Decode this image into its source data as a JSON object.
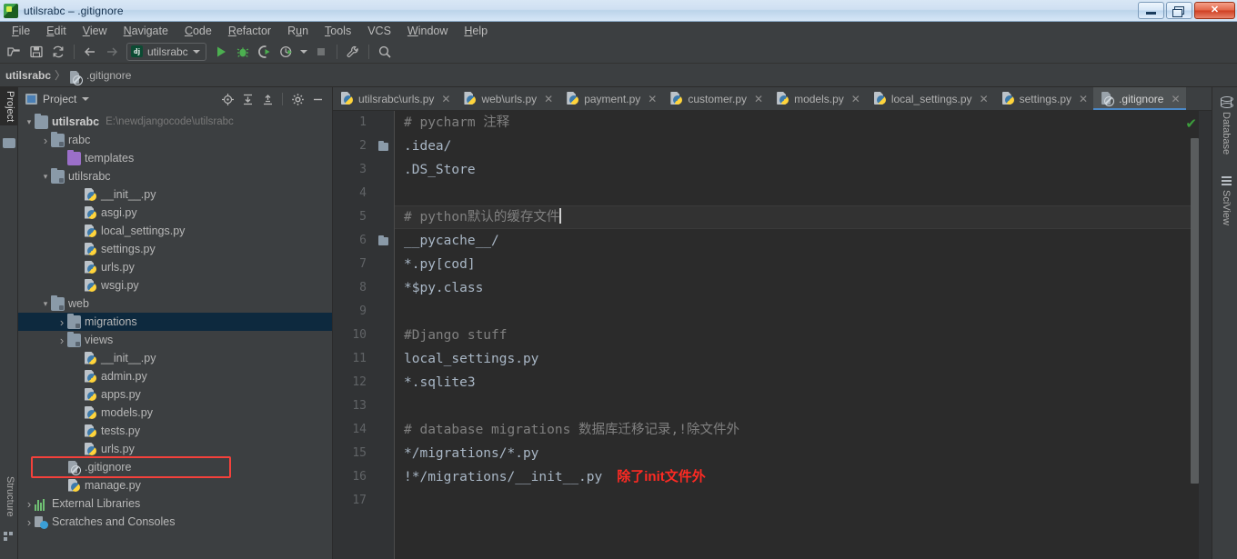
{
  "window": {
    "title": "utilsrabc – .gitignore",
    "icon": "pycharm-icon",
    "buttons": {
      "minimize": "minimize",
      "maximize": "maximize",
      "close": "close"
    }
  },
  "menubar": {
    "items": [
      {
        "label": "File",
        "mnemonic": "F"
      },
      {
        "label": "Edit",
        "mnemonic": "E"
      },
      {
        "label": "View",
        "mnemonic": "V"
      },
      {
        "label": "Navigate",
        "mnemonic": "N"
      },
      {
        "label": "Code",
        "mnemonic": "C"
      },
      {
        "label": "Refactor",
        "mnemonic": "R"
      },
      {
        "label": "Run",
        "mnemonic": "u"
      },
      {
        "label": "Tools",
        "mnemonic": "T"
      },
      {
        "label": "VCS",
        "mnemonic": ""
      },
      {
        "label": "Window",
        "mnemonic": "W"
      },
      {
        "label": "Help",
        "mnemonic": "H"
      }
    ]
  },
  "toolbar": {
    "open_label": "open-folder",
    "save_label": "save-all",
    "sync_label": "synchronize",
    "back_label": "navigate-back",
    "forward_label": "navigate-forward",
    "run_config_name": "utilsrabc",
    "run_label": "run",
    "debug_label": "debug",
    "run_coverage_label": "run-with-coverage",
    "profile_label": "profile",
    "stop_label": "stop",
    "settings_label": "settings",
    "search_label": "search-everywhere"
  },
  "breadcrumb": {
    "root": "utilsrabc",
    "separator": "〉",
    "leaf": ".gitignore"
  },
  "left_strip": {
    "tabs": [
      {
        "label": "Project",
        "active": true
      },
      {
        "label": "Structure",
        "active": false
      }
    ]
  },
  "right_strip": {
    "tabs": [
      {
        "label": "Database",
        "icon": "database-icon"
      },
      {
        "label": "SciView",
        "icon": "grid-icon"
      }
    ]
  },
  "project_panel": {
    "title": "Project",
    "actions": [
      {
        "name": "select-opened-file",
        "glyph": "⊕"
      },
      {
        "name": "expand-all",
        "glyph": "expand"
      },
      {
        "name": "collapse-all",
        "glyph": "collapse"
      },
      {
        "name": "settings",
        "glyph": "gear"
      },
      {
        "name": "hide",
        "glyph": "—"
      }
    ],
    "tree": [
      {
        "label": "utilsrabc",
        "path": "E:\\newdjangocode\\utilsrabc",
        "indent": 0,
        "arrow": "⌄",
        "icon": "folder",
        "bold": true,
        "selected": false
      },
      {
        "label": "rabc",
        "path": "",
        "indent": 1,
        "arrow": "›",
        "icon": "folder-module",
        "bold": false,
        "selected": false
      },
      {
        "label": "templates",
        "path": "",
        "indent": 2,
        "arrow": "",
        "icon": "folder-purple",
        "bold": false,
        "selected": false
      },
      {
        "label": "utilsrabc",
        "path": "",
        "indent": 1,
        "arrow": "⌄",
        "icon": "folder-module",
        "bold": false,
        "selected": false
      },
      {
        "label": "__init__.py",
        "path": "",
        "indent": 3,
        "arrow": "",
        "icon": "python-file",
        "bold": false,
        "selected": false
      },
      {
        "label": "asgi.py",
        "path": "",
        "indent": 3,
        "arrow": "",
        "icon": "python-file",
        "bold": false,
        "selected": false
      },
      {
        "label": "local_settings.py",
        "path": "",
        "indent": 3,
        "arrow": "",
        "icon": "python-file",
        "bold": false,
        "selected": false
      },
      {
        "label": "settings.py",
        "path": "",
        "indent": 3,
        "arrow": "",
        "icon": "python-file",
        "bold": false,
        "selected": false
      },
      {
        "label": "urls.py",
        "path": "",
        "indent": 3,
        "arrow": "",
        "icon": "python-file",
        "bold": false,
        "selected": false
      },
      {
        "label": "wsgi.py",
        "path": "",
        "indent": 3,
        "arrow": "",
        "icon": "python-file",
        "bold": false,
        "selected": false
      },
      {
        "label": "web",
        "path": "",
        "indent": 1,
        "arrow": "⌄",
        "icon": "folder-module",
        "bold": false,
        "selected": false
      },
      {
        "label": "migrations",
        "path": "",
        "indent": 2,
        "arrow": "›",
        "icon": "folder-module",
        "bold": false,
        "selected": true
      },
      {
        "label": "views",
        "path": "",
        "indent": 2,
        "arrow": "›",
        "icon": "folder-module",
        "bold": false,
        "selected": false
      },
      {
        "label": "__init__.py",
        "path": "",
        "indent": 3,
        "arrow": "",
        "icon": "python-file",
        "bold": false,
        "selected": false
      },
      {
        "label": "admin.py",
        "path": "",
        "indent": 3,
        "arrow": "",
        "icon": "python-file",
        "bold": false,
        "selected": false
      },
      {
        "label": "apps.py",
        "path": "",
        "indent": 3,
        "arrow": "",
        "icon": "python-file",
        "bold": false,
        "selected": false
      },
      {
        "label": "models.py",
        "path": "",
        "indent": 3,
        "arrow": "",
        "icon": "python-file",
        "bold": false,
        "selected": false
      },
      {
        "label": "tests.py",
        "path": "",
        "indent": 3,
        "arrow": "",
        "icon": "python-file",
        "bold": false,
        "selected": false
      },
      {
        "label": "urls.py",
        "path": "",
        "indent": 3,
        "arrow": "",
        "icon": "python-file",
        "bold": false,
        "selected": false
      },
      {
        "label": ".gitignore",
        "path": "",
        "indent": 2,
        "arrow": "",
        "icon": "gitignore-file",
        "bold": false,
        "selected": false
      },
      {
        "label": "manage.py",
        "path": "",
        "indent": 2,
        "arrow": "",
        "icon": "python-file",
        "bold": false,
        "selected": false
      },
      {
        "label": "External Libraries",
        "path": "",
        "indent": 0,
        "arrow": "›",
        "icon": "libraries",
        "bold": false,
        "selected": false
      },
      {
        "label": "Scratches and Consoles",
        "path": "",
        "indent": 0,
        "arrow": "›",
        "icon": "scratches",
        "bold": false,
        "selected": false
      }
    ],
    "highlight_annotation": {
      "target": ".gitignore",
      "color": "#f4413b"
    }
  },
  "editor": {
    "tabs": [
      {
        "label": "utilsrabc\\urls.py",
        "icon": "python-file",
        "active": false
      },
      {
        "label": "web\\urls.py",
        "icon": "python-file",
        "active": false
      },
      {
        "label": "payment.py",
        "icon": "python-file",
        "active": false
      },
      {
        "label": "customer.py",
        "icon": "python-file",
        "active": false
      },
      {
        "label": "models.py",
        "icon": "python-file",
        "active": false
      },
      {
        "label": "local_settings.py",
        "icon": "python-file",
        "active": false
      },
      {
        "label": "settings.py",
        "icon": "python-file",
        "active": false
      },
      {
        "label": ".gitignore",
        "icon": "gitignore-file",
        "active": true
      }
    ],
    "close_glyph": "✕",
    "inspection_status": "✔",
    "active_line": 5,
    "lines": [
      {
        "n": "1",
        "text": "# pycharm 注释",
        "comment": true,
        "fold": false
      },
      {
        "n": "2",
        "text": ".idea/",
        "comment": false,
        "fold": true
      },
      {
        "n": "3",
        "text": ".DS_Store",
        "comment": false,
        "fold": false
      },
      {
        "n": "4",
        "text": "",
        "comment": false,
        "fold": false
      },
      {
        "n": "5",
        "text": "# python默认的缓存文件",
        "comment": true,
        "fold": false
      },
      {
        "n": "6",
        "text": "__pycache__/",
        "comment": false,
        "fold": true
      },
      {
        "n": "7",
        "text": "*.py[cod]",
        "comment": false,
        "fold": false
      },
      {
        "n": "8",
        "text": "*$py.class",
        "comment": false,
        "fold": false
      },
      {
        "n": "9",
        "text": "",
        "comment": false,
        "fold": false
      },
      {
        "n": "10",
        "text": "#Django stuff",
        "comment": true,
        "fold": false
      },
      {
        "n": "11",
        "text": "local_settings.py",
        "comment": false,
        "fold": false
      },
      {
        "n": "12",
        "text": "*.sqlite3",
        "comment": false,
        "fold": false
      },
      {
        "n": "13",
        "text": "",
        "comment": false,
        "fold": false
      },
      {
        "n": "14",
        "text": "# database migrations 数据库迁移记录,!除文件外",
        "comment": true,
        "fold": false
      },
      {
        "n": "15",
        "text": "*/migrations/*.py",
        "comment": false,
        "fold": false
      },
      {
        "n": "16",
        "text": "!*/migrations/__init__.py",
        "comment": false,
        "fold": false
      },
      {
        "n": "17",
        "text": "",
        "comment": false,
        "fold": false
      }
    ],
    "annotations": [
      {
        "line": 16,
        "text": "除了init文件外",
        "color": "#ff2a23"
      }
    ]
  },
  "colors": {
    "accent": "#4a88c7",
    "editor_bg": "#2b2b2b",
    "panel_bg": "#3c3f41",
    "selection": "#0d293e",
    "annotation_red": "#ff2a23",
    "ok_green": "#3c9e3c"
  }
}
